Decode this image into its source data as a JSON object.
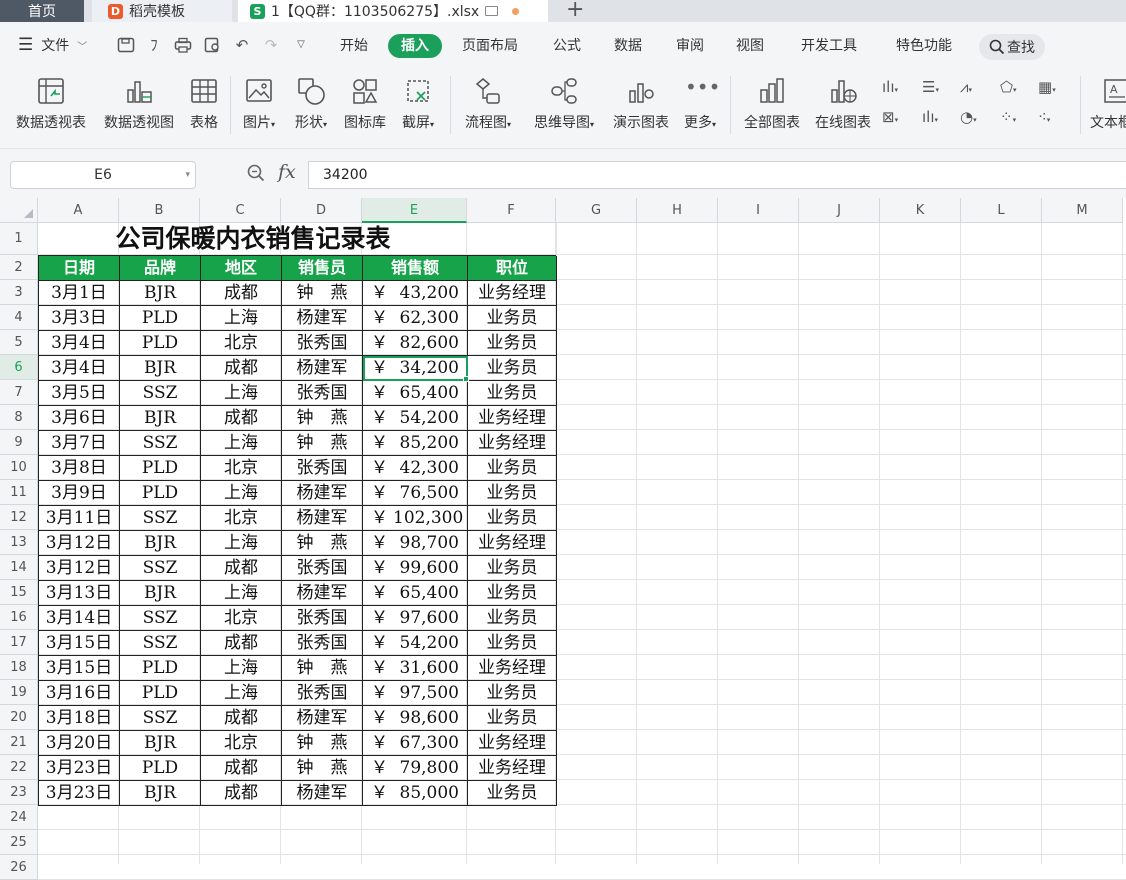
{
  "tabs": {
    "home": "首页",
    "template": "稻壳模板",
    "file": "1【QQ群：1103506275】.xlsx",
    "file_logo": "S",
    "template_logo": "D"
  },
  "menu": {
    "file_label": "文件",
    "tabs": [
      "开始",
      "插入",
      "页面布局",
      "公式",
      "数据",
      "审阅",
      "视图",
      "开发工具",
      "特色功能"
    ],
    "active_tab": "插入",
    "search_label": "查找"
  },
  "ribbon": {
    "buttons": [
      "数据透视表",
      "数据透视图",
      "表格",
      "图片",
      "形状",
      "图标库",
      "截屏",
      "流程图",
      "思维导图",
      "演示图表",
      "更多",
      "全部图表",
      "在线图表",
      "文本框"
    ]
  },
  "formula_bar": {
    "cell_ref": "E6",
    "formula": "34200",
    "fx_label": "fx"
  },
  "sheet": {
    "columns": [
      "A",
      "B",
      "C",
      "D",
      "E",
      "F",
      "G",
      "H",
      "I",
      "J",
      "K",
      "L",
      "M"
    ],
    "selected_column": "E",
    "selected_row": "6",
    "rows": [
      "1",
      "2",
      "3",
      "4",
      "5",
      "6",
      "7",
      "8",
      "9",
      "10",
      "11",
      "12",
      "13",
      "14",
      "15",
      "16",
      "17",
      "18",
      "19",
      "20",
      "21",
      "22",
      "23",
      "24",
      "25",
      "26"
    ],
    "title": "公司保暖内衣销售记录表",
    "headers": [
      "日期",
      "品牌",
      "地区",
      "销售员",
      "销售额",
      "职位"
    ],
    "currency_symbol": "￥",
    "records": [
      [
        "3月1日",
        "BJR",
        "成都",
        "钟　燕",
        "43,200",
        "业务经理"
      ],
      [
        "3月3日",
        "PLD",
        "上海",
        "杨建军",
        "62,300",
        "业务员"
      ],
      [
        "3月4日",
        "PLD",
        "北京",
        "张秀国",
        "82,600",
        "业务员"
      ],
      [
        "3月4日",
        "BJR",
        "成都",
        "杨建军",
        "34,200",
        "业务员"
      ],
      [
        "3月5日",
        "SSZ",
        "上海",
        "张秀国",
        "65,400",
        "业务员"
      ],
      [
        "3月6日",
        "BJR",
        "成都",
        "钟　燕",
        "54,200",
        "业务经理"
      ],
      [
        "3月7日",
        "SSZ",
        "上海",
        "钟　燕",
        "85,200",
        "业务经理"
      ],
      [
        "3月8日",
        "PLD",
        "北京",
        "张秀国",
        "42,300",
        "业务员"
      ],
      [
        "3月9日",
        "PLD",
        "上海",
        "杨建军",
        "76,500",
        "业务员"
      ],
      [
        "3月11日",
        "SSZ",
        "北京",
        "杨建军",
        "102,300",
        "业务员"
      ],
      [
        "3月12日",
        "BJR",
        "上海",
        "钟　燕",
        "98,700",
        "业务经理"
      ],
      [
        "3月12日",
        "SSZ",
        "成都",
        "张秀国",
        "99,600",
        "业务员"
      ],
      [
        "3月13日",
        "BJR",
        "上海",
        "杨建军",
        "65,400",
        "业务员"
      ],
      [
        "3月14日",
        "SSZ",
        "北京",
        "张秀国",
        "97,600",
        "业务员"
      ],
      [
        "3月15日",
        "SSZ",
        "成都",
        "张秀国",
        "54,200",
        "业务员"
      ],
      [
        "3月15日",
        "PLD",
        "上海",
        "钟　燕",
        "31,600",
        "业务经理"
      ],
      [
        "3月16日",
        "PLD",
        "上海",
        "张秀国",
        "97,500",
        "业务员"
      ],
      [
        "3月18日",
        "SSZ",
        "成都",
        "杨建军",
        "98,600",
        "业务员"
      ],
      [
        "3月20日",
        "BJR",
        "北京",
        "钟　燕",
        "67,300",
        "业务经理"
      ],
      [
        "3月23日",
        "PLD",
        "成都",
        "钟　燕",
        "79,800",
        "业务经理"
      ],
      [
        "3月23日",
        "BJR",
        "成都",
        "杨建军",
        "85,000",
        "业务员"
      ]
    ],
    "active_record_index": 3
  },
  "colors": {
    "accent": "#1aa05a",
    "header_fill": "#16a34a"
  }
}
